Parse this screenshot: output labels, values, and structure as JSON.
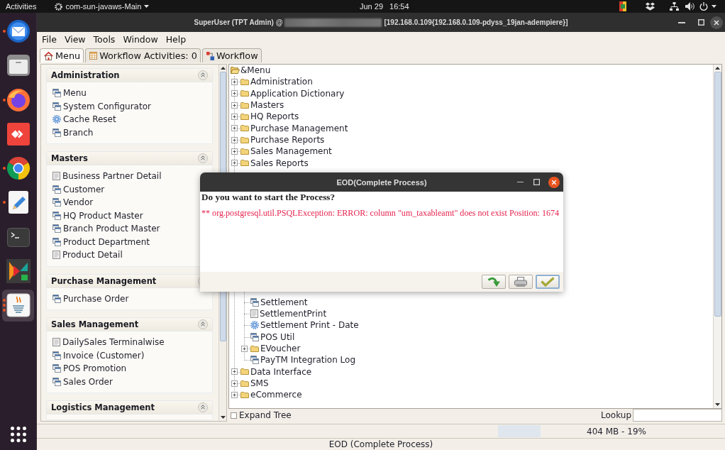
{
  "top_bar": {
    "activities": "Activities",
    "app_menu": "com-sun-javaws-Main",
    "clock_date": "Jun 29",
    "clock_time": "16:54",
    "tray": [
      {
        "kind": "indicator"
      },
      {
        "kind": "dropbox"
      },
      {
        "kind": "network"
      },
      {
        "kind": "volume"
      },
      {
        "kind": "power"
      }
    ]
  },
  "dock": {
    "apps": [
      {
        "kind": "mail",
        "running": true,
        "selected": false,
        "multiwindow": false
      },
      {
        "kind": "files",
        "running": false,
        "selected": false
      },
      {
        "kind": "globe",
        "running": true,
        "selected": false,
        "multiwindow": false
      },
      {
        "kind": "diamonds",
        "running": false,
        "selected": false
      },
      {
        "kind": "wheel",
        "running": true,
        "selected": false,
        "multiwindow": false
      },
      {
        "kind": "editor",
        "running": true,
        "selected": false,
        "multiwindow": false
      },
      {
        "kind": "terminal",
        "running": false,
        "selected": false
      },
      {
        "kind": "triangles",
        "running": false,
        "selected": false
      },
      {
        "kind": "coffee",
        "running": true,
        "selected": true,
        "multiwindow": true
      }
    ]
  },
  "window": {
    "title": "SuperUser (TPT Admin) @",
    "title_suffix": "[192.168.0.109{192.168.0.109-pdyss_19jan-adempiere}]"
  },
  "menu_bar": [
    {
      "label": "File"
    },
    {
      "label": "View"
    },
    {
      "label": "Tools"
    },
    {
      "label": "Window"
    },
    {
      "label": "Help"
    }
  ],
  "tabs": [
    {
      "label": "Menu",
      "kind": "home",
      "selected": true
    },
    {
      "label": "Workflow Activities: 0",
      "kind": "activities",
      "selected": false
    },
    {
      "label": "Workflow",
      "kind": "workflow",
      "selected": false
    }
  ],
  "sidebar": {
    "sections": [
      {
        "title": "Administration",
        "expanded": true,
        "items": [
          {
            "label": "Menu",
            "kind": "window"
          },
          {
            "label": "System Configurator",
            "kind": "window"
          },
          {
            "label": "Cache Reset",
            "kind": "process"
          },
          {
            "label": "Branch",
            "kind": "window"
          }
        ]
      },
      {
        "title": "Masters",
        "expanded": true,
        "items": [
          {
            "label": "Business Partner Detail",
            "kind": "report"
          },
          {
            "label": "Customer",
            "kind": "window"
          },
          {
            "label": "Vendor",
            "kind": "window"
          },
          {
            "label": "HQ Product Master",
            "kind": "window"
          },
          {
            "label": "Branch Product Master",
            "kind": "window"
          },
          {
            "label": "Product Department",
            "kind": "window"
          },
          {
            "label": "Product Detail",
            "kind": "report"
          }
        ]
      },
      {
        "title": "Purchase Management",
        "expanded": true,
        "items": [
          {
            "label": "Purchase Order",
            "kind": "window"
          }
        ]
      },
      {
        "title": "Sales Management",
        "expanded": true,
        "items": [
          {
            "label": "DailySales Terminalwise",
            "kind": "report"
          },
          {
            "label": "Invoice (Customer)",
            "kind": "window"
          },
          {
            "label": "POS Promotion",
            "kind": "window"
          },
          {
            "label": "Sales Order",
            "kind": "window"
          }
        ]
      },
      {
        "title": "Logistics Management",
        "expanded": true
      }
    ]
  },
  "tree": {
    "label": "&Menu",
    "expanded": true,
    "children": [
      {
        "label": "Administration",
        "kind": "folder",
        "expanded": false
      },
      {
        "label": "Application Dictionary",
        "kind": "folder",
        "expanded": false
      },
      {
        "label": "Masters",
        "kind": "folder",
        "expanded": false
      },
      {
        "label": "HQ Reports",
        "kind": "folder",
        "expanded": false
      },
      {
        "label": "Purchase Management",
        "kind": "folder",
        "expanded": false
      },
      {
        "label": "Purchase Reports",
        "kind": "folder",
        "expanded": false
      },
      {
        "label": "Sales Management",
        "kind": "folder",
        "expanded": false
      },
      {
        "label": "Sales Reports",
        "kind": "folder",
        "expanded": false
      },
      {
        "expanded": true,
        "children": [
          {
            "label": "Settlement",
            "kind": "window"
          },
          {
            "label": "SettlementPrint",
            "kind": "report"
          },
          {
            "label": "Settlement Print - Date",
            "kind": "process"
          },
          {
            "label": "POS Util",
            "kind": "window"
          },
          {
            "label": "EVoucher",
            "kind": "folder",
            "expanded": false
          },
          {
            "label": "PayTM Integration Log",
            "kind": "window"
          }
        ]
      },
      {
        "label": "Data Interface",
        "kind": "folder",
        "expanded": false
      },
      {
        "label": "SMS",
        "kind": "folder",
        "expanded": false
      },
      {
        "label": "eCommerce",
        "kind": "folder",
        "expanded": false
      }
    ]
  },
  "tree_footer": {
    "expand_tree": {
      "label": "Expand Tree",
      "checked": false
    },
    "lookup": {
      "label": "Lookup"
    }
  },
  "status_bar": {
    "memory": "404 MB - 19%",
    "message": "EOD (Complete Process)"
  },
  "dialog": {
    "title": "EOD(Complete Process)",
    "question": "Do you want to start the Process?",
    "message": "** org.postgresql.util.PSQLException: ERROR: column \"um_taxableamt\" does not exist Position: 1674",
    "buttons": [
      {
        "kind": "arrow",
        "focused": false
      },
      {
        "kind": "print",
        "focused": false
      },
      {
        "kind": "ok",
        "focused": true
      }
    ]
  }
}
